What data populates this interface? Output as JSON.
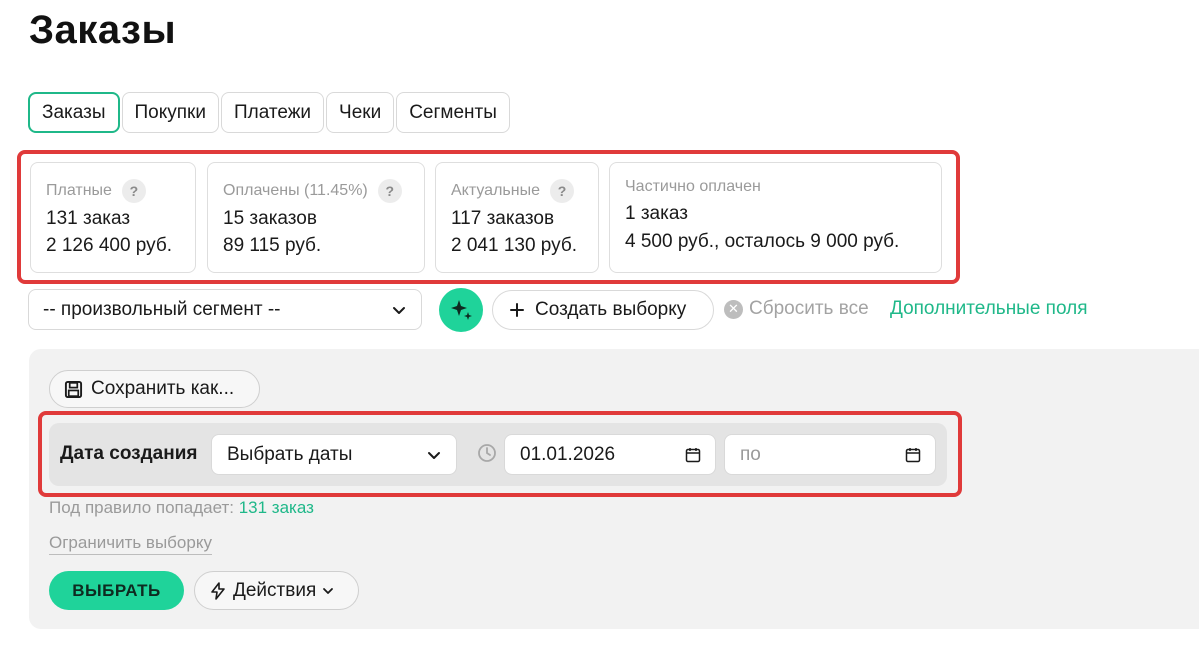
{
  "page": {
    "title": "Заказы"
  },
  "tabs": [
    {
      "label": "Заказы",
      "active": true
    },
    {
      "label": "Покупки",
      "active": false
    },
    {
      "label": "Платежи",
      "active": false
    },
    {
      "label": "Чеки",
      "active": false
    },
    {
      "label": "Сегменты",
      "active": false
    }
  ],
  "stats": [
    {
      "title": "Платные",
      "help": "?",
      "line1": "131 заказ",
      "line2": "2 126 400 руб."
    },
    {
      "title": "Оплачены (11.45%)",
      "help": "?",
      "line1": "15 заказов",
      "line2": "89 115 руб."
    },
    {
      "title": "Актуальные",
      "help": "?",
      "line1": "117 заказов",
      "line2": "2 041 130 руб."
    },
    {
      "title": "Частично оплачен",
      "line1": "1 заказ",
      "line2": "4 500 руб., осталось 9 000 руб."
    }
  ],
  "toolbar": {
    "segment_value": "-- произвольный сегмент --",
    "create_label": "Создать выборку",
    "reset_label": "Сбросить все",
    "extra_fields_label": "Дополнительные поля"
  },
  "filter": {
    "save_label": "Сохранить как...",
    "rule_label": "Дата создания",
    "rule_select": "Выбрать даты",
    "date_from": "01.01.2026",
    "date_to_placeholder": "по",
    "match_prefix": "Под правило попадает:",
    "match_count": "131 заказ",
    "limit_label": "Ограничить выборку",
    "select_button": "ВЫБРАТЬ",
    "actions_label": "Действия"
  },
  "colors": {
    "accent": "#1fd39a",
    "accent_text": "#1fb889",
    "highlight": "#e03a3a",
    "panel_bg": "#f2f2f2"
  }
}
